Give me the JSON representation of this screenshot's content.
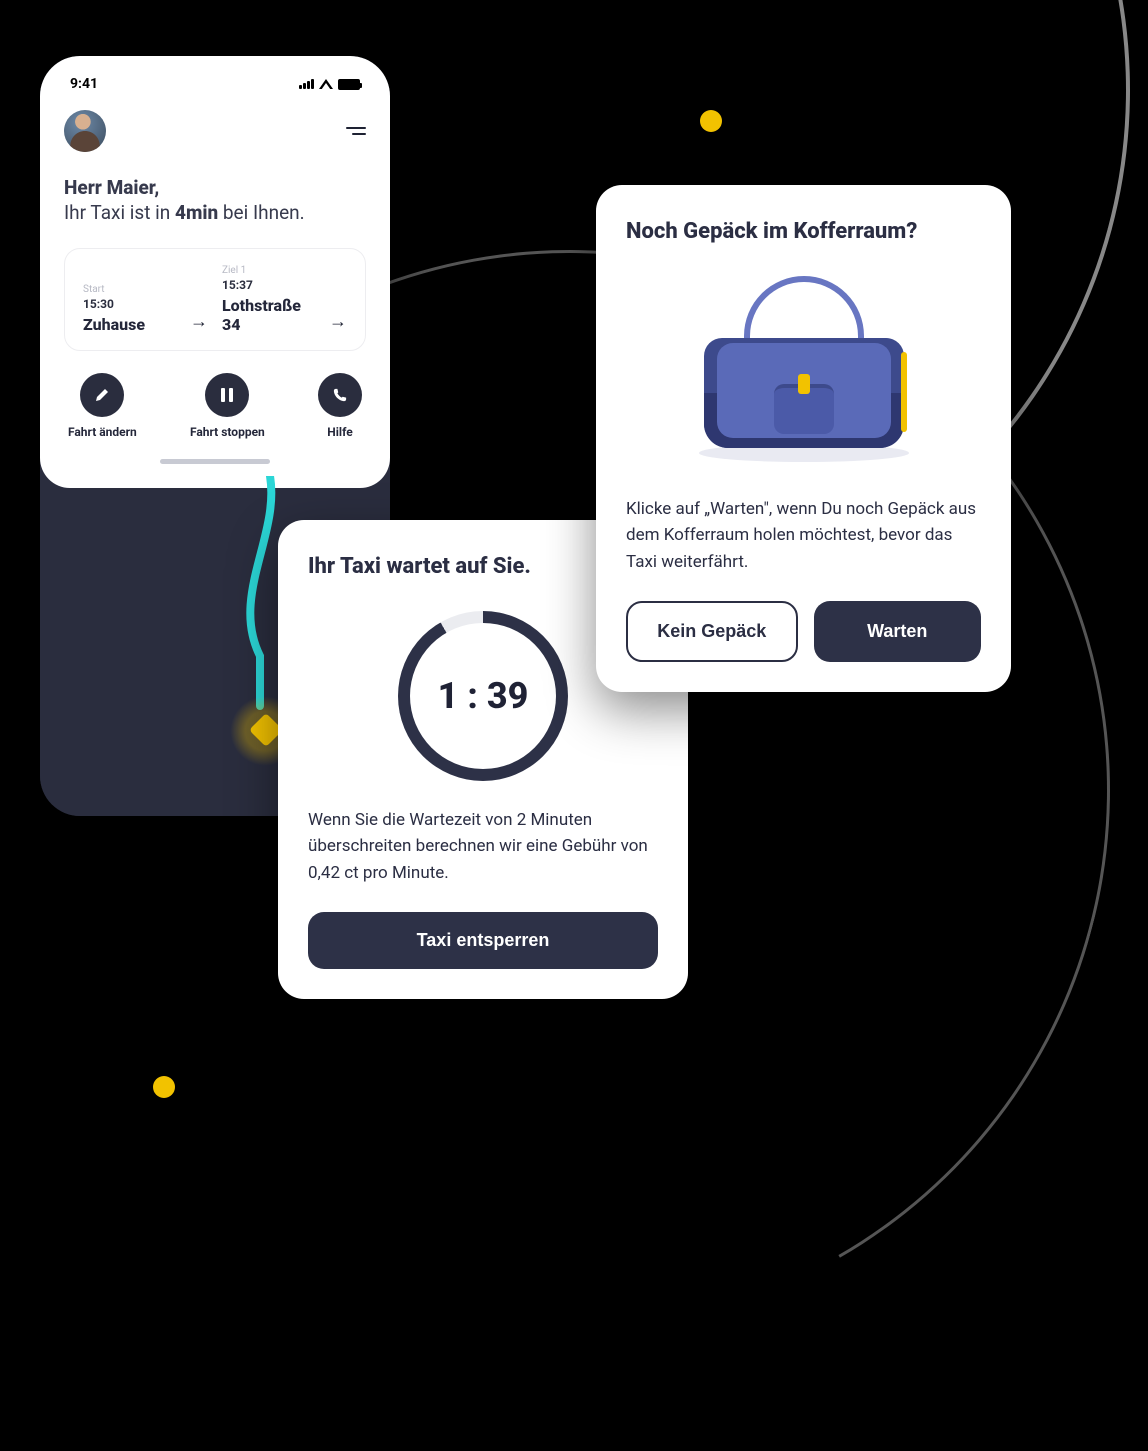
{
  "decor": {},
  "phone": {
    "status_time": "9:41",
    "greeting": "Herr Maier,",
    "sub_prefix": "Ihr Taxi ist in ",
    "sub_eta": "4min",
    "sub_suffix": " bei Ihnen.",
    "route": {
      "start_label": "Start",
      "start_time": "15:30",
      "start_place": "Zuhause",
      "dest_label": "Ziel 1",
      "dest_time": "15:37",
      "dest_place": "Lothstraße 34"
    },
    "actions": {
      "edit": "Fahrt ändern",
      "stop": "Fahrt stoppen",
      "help": "Hilfe"
    }
  },
  "wait": {
    "title": "Ihr Taxi wartet auf Sie.",
    "timer": "1 : 39",
    "body": "Wenn Sie die Wartezeit von 2 Minuten überschreiten berechnen wir eine Gebühr von 0,42 ct pro Minute.",
    "unlock": "Taxi entsperren"
  },
  "luggage": {
    "title": "Noch Gepäck im Kofferraum?",
    "body": "Klicke auf „Warten\", wenn Du noch Gepäck aus dem Kofferraum holen möchtest, bevor das Taxi weiterfährt.",
    "btn_no": "Kein Gepäck",
    "btn_wait": "Warten"
  }
}
